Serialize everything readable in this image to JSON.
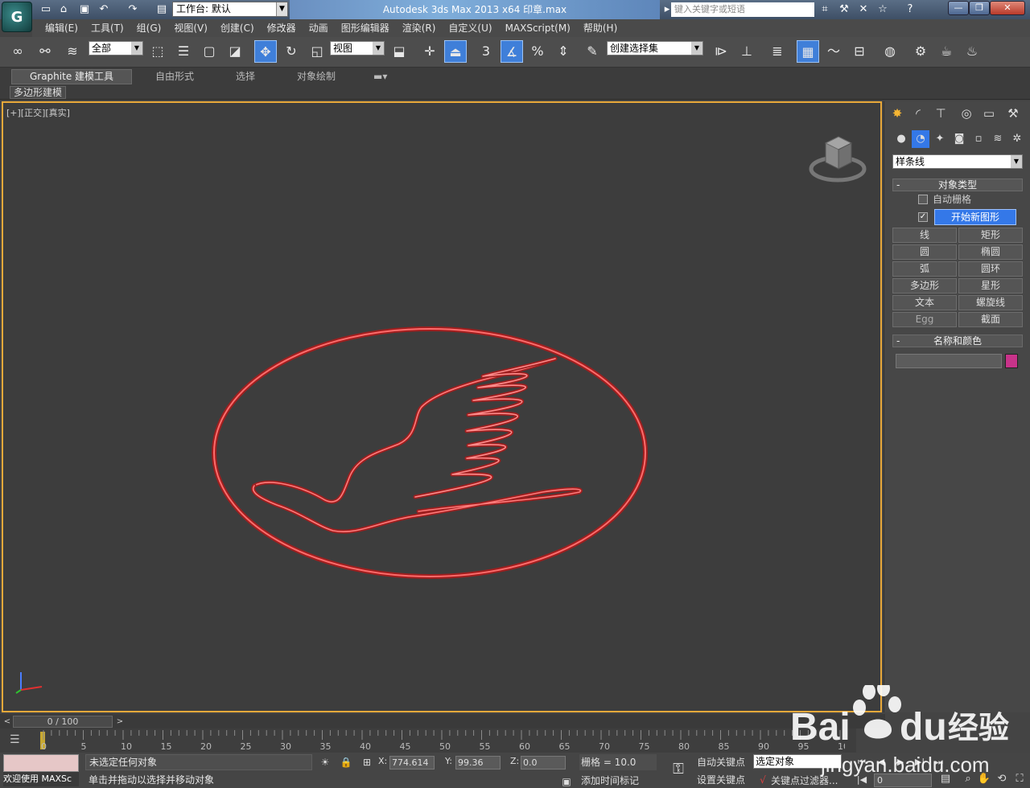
{
  "titlebar": {
    "workspace_value": "工作台: 默认",
    "title": "Autodesk 3ds Max  2013 x64      印章.max",
    "search_placeholder": "键入关键字或短语"
  },
  "menu": [
    "编辑(E)",
    "工具(T)",
    "组(G)",
    "视图(V)",
    "创建(C)",
    "修改器",
    "动画",
    "图形编辑器",
    "渲染(R)",
    "自定义(U)",
    "MAXScript(M)",
    "帮助(H)"
  ],
  "toolbar": {
    "selection_filter": "全部",
    "ref_coord": "视图",
    "named_selection": "创建选择集",
    "snap_3": "3",
    "percent_snap": "%"
  },
  "ribbon": {
    "tabs": [
      "Graphite 建模工具",
      "自由形式",
      "选择",
      "对象绘制"
    ],
    "sub_panel": "多边形建模"
  },
  "viewport": {
    "label": "[+][正交][真实]",
    "shape_color": "#e23b3b",
    "border_color": "#e9a93a"
  },
  "command_panel": {
    "category": "样条线",
    "object_type_title": "对象类型",
    "auto_grid": "自动栅格",
    "start_new_shape": "开始新图形",
    "buttons": [
      "线",
      "矩形",
      "圆",
      "椭圆",
      "弧",
      "圆环",
      "多边形",
      "星形",
      "文本",
      "螺旋线",
      "Egg",
      "截面"
    ],
    "name_color_title": "名称和颜色",
    "swatch_color": "#c8338a"
  },
  "timeline": {
    "slider": "0 / 100",
    "ticks": [
      "0",
      "5",
      "10",
      "15",
      "20",
      "25",
      "30",
      "35",
      "40",
      "45",
      "50",
      "55",
      "60",
      "65",
      "70",
      "75",
      "80",
      "85",
      "90",
      "95",
      "100"
    ]
  },
  "status": {
    "welcome": "欢迎使用 MAXSc",
    "selection": "未选定任何对象",
    "prompt": "单击并拖动以选择并移动对象",
    "x_label": "X:",
    "x_value": "774.614",
    "y_label": "Y:",
    "y_value": "99.36",
    "z_label": "Z:",
    "z_value": "0.0",
    "grid": "栅格 = 10.0",
    "add_time_tag": "添加时间标记",
    "auto_key": "自动关键点",
    "key_select": "选定对象",
    "set_key": "设置关键点",
    "key_filters": "关键点过滤器...",
    "frame": "0"
  },
  "watermark": {
    "brand": "Bai",
    "brand_cn": "经验",
    "url": "jingyan.baidu.com"
  }
}
